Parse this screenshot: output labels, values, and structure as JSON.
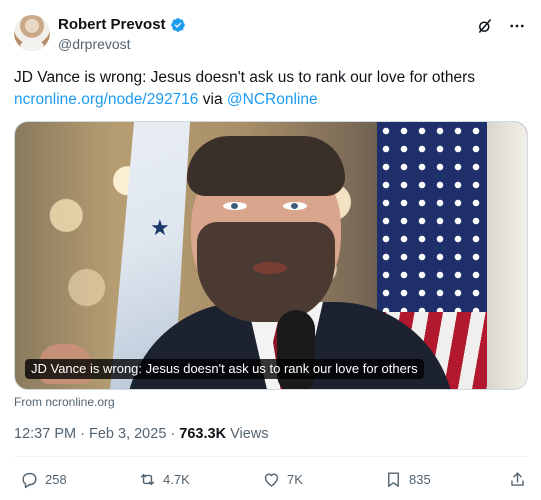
{
  "author": {
    "display_name": "Robert Prevost",
    "handle": "@drprevost",
    "verified_color": "#1d9bf0"
  },
  "header_icons": [
    "grok-icon",
    "more-icon"
  ],
  "tweet": {
    "text": "JD Vance is wrong: Jesus doesn't ask us to rank our love for others",
    "link_url": "ncronline.org/node/292716",
    "via_word": "via",
    "mention": "@NCRonline"
  },
  "media": {
    "caption": "JD Vance is wrong: Jesus doesn't ask us to rank our love for others",
    "source": "From ncronline.org"
  },
  "meta": {
    "time": "12:37 PM",
    "separator": "·",
    "date": "Feb 3, 2025",
    "views_count": "763.3K",
    "views_label": "Views"
  },
  "actions": {
    "replies": "258",
    "reposts": "4.7K",
    "likes": "7K",
    "bookmarks": "835"
  },
  "colors": {
    "link": "#1d9bf0",
    "secondary_text": "#536471",
    "primary_text": "#0f1419"
  }
}
